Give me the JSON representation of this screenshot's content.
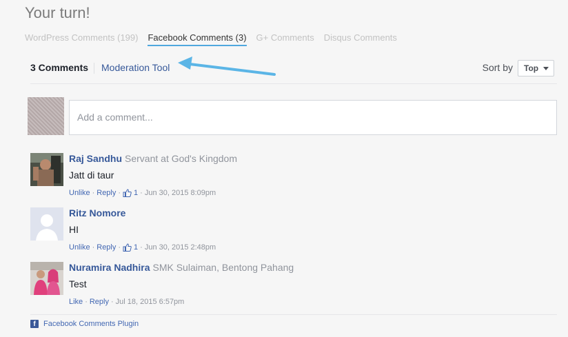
{
  "page": {
    "heading": "Your turn!"
  },
  "tabs": [
    {
      "label": "WordPress Comments (199)",
      "active": false
    },
    {
      "label": "Facebook Comments (3)",
      "active": true
    },
    {
      "label": "G+ Comments",
      "active": false
    },
    {
      "label": "Disqus Comments",
      "active": false
    }
  ],
  "fb": {
    "count_label": "3 Comments",
    "moderation_label": "Moderation Tool",
    "sort_label": "Sort by",
    "sort_value": "Top",
    "composer_placeholder": "Add a comment...",
    "plugin_label": "Facebook Comments Plugin",
    "accent_color": "#365899",
    "arrow_color": "#5bb5e6"
  },
  "comments": [
    {
      "author": "Raj Sandhu",
      "role": "Servant at God's Kingdom",
      "text": "Jatt di taur",
      "actions": {
        "unlike": "Unlike",
        "reply": "Reply",
        "likes": "1",
        "date": "Jun 30, 2015 8:09pm"
      }
    },
    {
      "author": "Ritz Nomore",
      "role": "",
      "text": "HI",
      "actions": {
        "unlike": "Unlike",
        "reply": "Reply",
        "likes": "1",
        "date": "Jun 30, 2015 2:48pm"
      }
    },
    {
      "author": "Nuramira Nadhira",
      "role": "SMK Sulaiman, Bentong Pahang",
      "text": "Test",
      "actions": {
        "like": "Like",
        "reply": "Reply",
        "date": "Jul 18, 2015 6:57pm"
      }
    }
  ]
}
